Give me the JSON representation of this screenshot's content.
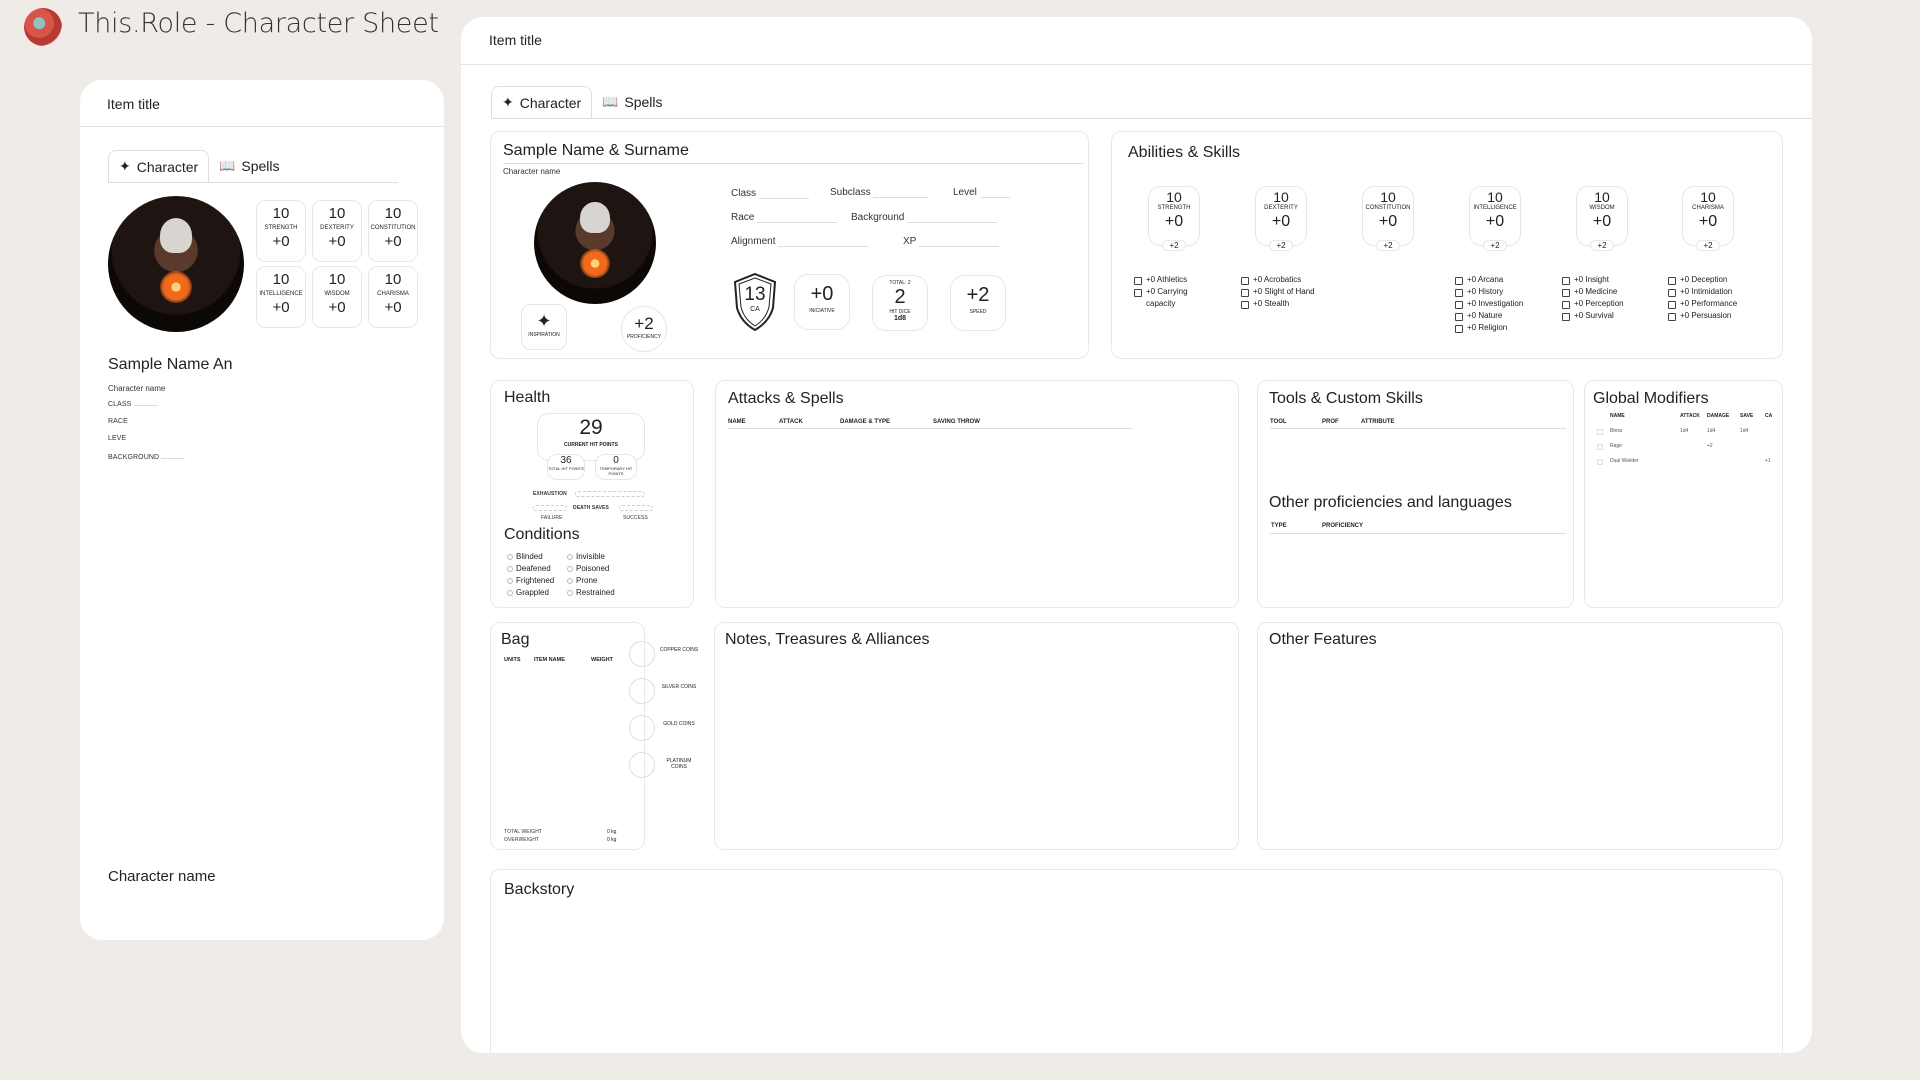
{
  "app": {
    "title": "This.Role - Character Sheet"
  },
  "left_panel": {
    "item_title": "Item title",
    "tabs": [
      {
        "label": "Character"
      },
      {
        "label": "Spells"
      }
    ],
    "stats": [
      {
        "value": "10",
        "label": "STRENGTH",
        "mod": "+0"
      },
      {
        "value": "10",
        "label": "DEXTERITY",
        "mod": "+0"
      },
      {
        "value": "10",
        "label": "CONSTITUTION",
        "mod": "+0"
      },
      {
        "value": "10",
        "label": "INTELLIGENCE",
        "mod": "+0"
      },
      {
        "value": "10",
        "label": "WISDOM",
        "mod": "+0"
      },
      {
        "value": "10",
        "label": "CHARISMA",
        "mod": "+0"
      }
    ],
    "name": "Sample Name An",
    "name_caption": "Character name",
    "fields": [
      {
        "label": "CLASS"
      },
      {
        "label": "RACE"
      },
      {
        "label": "LEVE"
      },
      {
        "label": "BACKGROUND"
      }
    ],
    "footer": "Character name"
  },
  "main": {
    "item_title": "Item title",
    "tabs": [
      {
        "label": "Character"
      },
      {
        "label": "Spells"
      }
    ],
    "character": {
      "name": "Sample Name & Surname",
      "name_caption": "Character name",
      "fields": {
        "class": "Class",
        "subclass": "Subclass",
        "level": "Level",
        "race": "Race",
        "background": "Background",
        "alignment": "Alignment",
        "xp": "XP"
      },
      "inspiration_label": "INSPIRATION",
      "proficiency": {
        "value": "+2",
        "label": "PROFICIENCY"
      },
      "ca": {
        "value": "13",
        "label": "CA"
      },
      "initiative": {
        "value": "+0",
        "label": "INICIATIVE"
      },
      "hit_dice": {
        "total_label": "TOTAL: 2",
        "value": "2",
        "label": "HIT DICE",
        "die": "1d8"
      },
      "speed": {
        "value": "+2",
        "label": "SPEED"
      }
    },
    "abilities": {
      "title": "Abilities & Skills",
      "items": [
        {
          "value": "10",
          "label": "STRENGTH",
          "mod": "+0",
          "save": "+2",
          "skills": [
            "+0 Athletics",
            "+0 Carrying capacity"
          ]
        },
        {
          "value": "10",
          "label": "DEXTERITY",
          "mod": "+0",
          "save": "+2",
          "skills": [
            "+0 Acrobatics",
            "+0 Slight of Hand",
            "+0 Stealth"
          ]
        },
        {
          "value": "10",
          "label": "CONSTITUTION",
          "mod": "+0",
          "save": "+2",
          "skills": []
        },
        {
          "value": "10",
          "label": "INTELLIGENCE",
          "mod": "+0",
          "save": "+2",
          "skills": [
            "+0 Arcana",
            "+0 History",
            "+0 Investigation",
            "+0 Nature",
            "+0 Religion"
          ]
        },
        {
          "value": "10",
          "label": "WISDOM",
          "mod": "+0",
          "save": "+2",
          "skills": [
            "+0 Insight",
            "+0 Medicine",
            "+0 Perception",
            "+0 Survival"
          ]
        },
        {
          "value": "10",
          "label": "CHARISMA",
          "mod": "+0",
          "save": "+2",
          "skills": [
            "+0 Deception",
            "+0 Intimidation",
            "+0 Performance",
            "+0 Persuasion"
          ]
        }
      ]
    },
    "health": {
      "title": "Health",
      "current": "29",
      "current_label": "CURRENT HIT POINTS",
      "total": "36",
      "total_label": "TOTAL HIT POINTS",
      "temp": "0",
      "temp_label": "TEMPORARY HIT POINTS",
      "exhaustion": "EXHAUSTION",
      "death_saves": "DEATH SAVES",
      "failure": "FAILURE",
      "success": "SUCCESS"
    },
    "conditions": {
      "title": "Conditions",
      "items": [
        "Blinded",
        "Invisible",
        "Deafened",
        "Poisoned",
        "Frightened",
        "Prone",
        "Grappled",
        "Restrained"
      ]
    },
    "attacks": {
      "title": "Attacks & Spells",
      "headers": [
        "NAME",
        "ATTACK",
        "DAMAGE & TYPE",
        "SAVING THROW"
      ]
    },
    "tools": {
      "title": "Tools & Custom Skills",
      "headers": [
        "TOOL",
        "PROF",
        "ATTRIBUTE"
      ]
    },
    "other_prof": {
      "title": "Other proficiencies and languages",
      "headers": [
        "TYPE",
        "PROFICIENCY"
      ]
    },
    "global": {
      "title": "Global Modifiers",
      "headers": [
        "NAME",
        "ATTACK",
        "DAMAGE",
        "SAVE",
        "CA"
      ],
      "rows": [
        [
          "Bless",
          "1d4",
          "1d4",
          "1d4",
          ""
        ],
        [
          "Rage",
          "",
          "+2",
          "",
          ""
        ],
        [
          "Dual Wielder",
          "",
          "",
          "",
          "+1"
        ]
      ]
    },
    "bag": {
      "title": "Bag",
      "headers": [
        "UNITS",
        "ITEM NAME",
        "WEIGHT"
      ],
      "coins": [
        "COPPER COINS",
        "SILVER COINS",
        "GOLD COINS",
        "PLATINUM COINS"
      ],
      "total_weight_label": "TOTAL WEIGHT",
      "total_weight": "0 kg",
      "overweight_label": "OVERWEIGHT",
      "overweight": "0 kg"
    },
    "notes": {
      "title": "Notes, Treasures & Alliances"
    },
    "features": {
      "title": "Other Features"
    },
    "backstory": {
      "title": "Backstory"
    }
  }
}
